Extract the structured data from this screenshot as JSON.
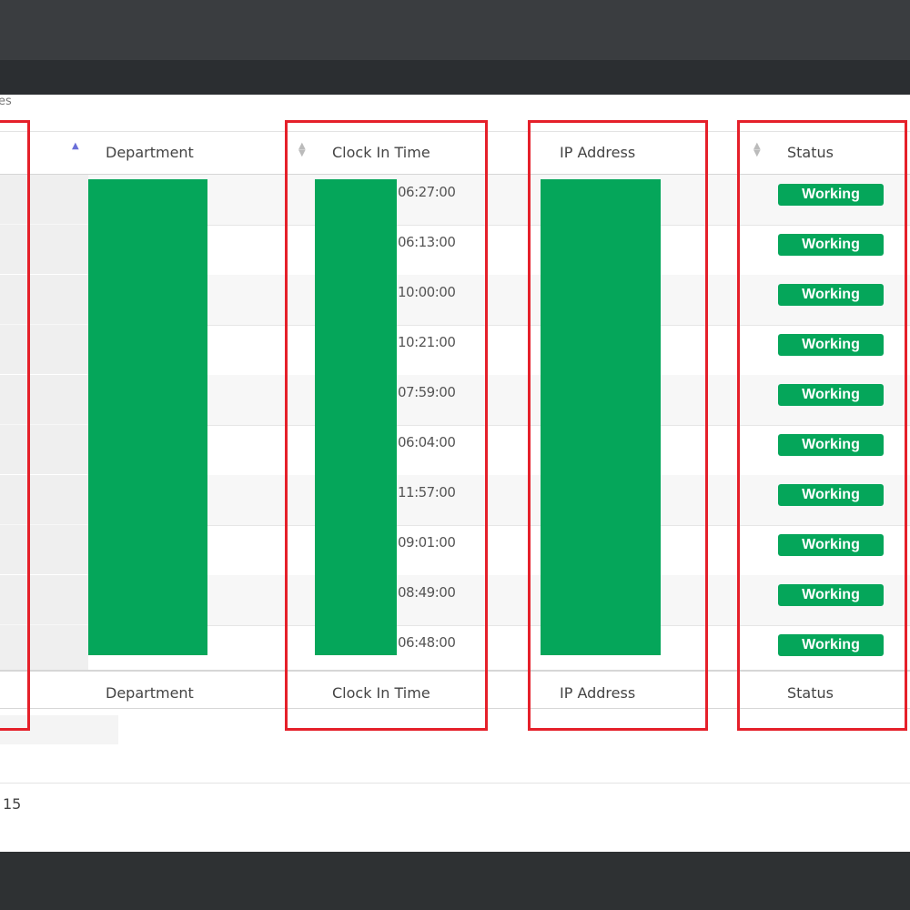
{
  "header": {
    "entries_text": "es"
  },
  "columns": {
    "department": "Department",
    "clock_in": "Clock In Time",
    "ip": "IP Address",
    "status": "Status"
  },
  "footer_columns": {
    "department": "Department",
    "clock_in": "Clock In Time",
    "ip": "IP Address",
    "status": "Status"
  },
  "rows": [
    {
      "clock_in": "06:27:00",
      "status": "Working"
    },
    {
      "clock_in": "06:13:00",
      "status": "Working"
    },
    {
      "clock_in": "10:00:00",
      "status": "Working"
    },
    {
      "clock_in": "10:21:00",
      "status": "Working"
    },
    {
      "clock_in": "07:59:00",
      "status": "Working"
    },
    {
      "clock_in": "06:04:00",
      "status": "Working"
    },
    {
      "clock_in": "11:57:00",
      "status": "Working"
    },
    {
      "clock_in": "09:01:00",
      "status": "Working"
    },
    {
      "clock_in": "08:49:00",
      "status": "Working"
    },
    {
      "clock_in": "06:48:00",
      "status": "Working"
    }
  ],
  "pagination": {
    "count_text": "15"
  },
  "colors": {
    "status_green": "#05a65a",
    "highlight_red": "#e5202a",
    "mask_green": "#05a65a"
  }
}
